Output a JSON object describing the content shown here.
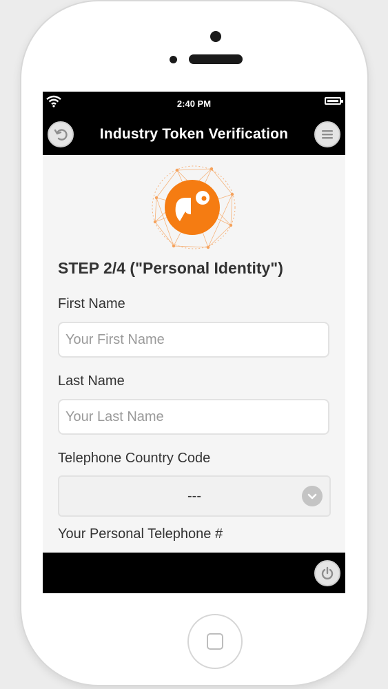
{
  "status_bar": {
    "time": "2:40 PM"
  },
  "header": {
    "title": "Industry Token Verification"
  },
  "form": {
    "step_title": "STEP 2/4 (\"Personal Identity\")",
    "first_name": {
      "label": "First Name",
      "placeholder": "Your First Name",
      "value": ""
    },
    "last_name": {
      "label": "Last Name",
      "placeholder": "Your Last Name",
      "value": ""
    },
    "country_code": {
      "label": "Telephone Country Code",
      "selected": "---"
    },
    "telephone": {
      "label": "Your Personal Telephone #"
    }
  },
  "icons": {
    "wifi": "wifi-icon",
    "battery": "battery-icon",
    "back": "back-arrow-icon",
    "menu": "menu-icon",
    "chevron": "chevron-down-icon",
    "power": "power-icon",
    "logo": "brand-logo"
  },
  "colors": {
    "brand_orange": "#f57c12",
    "header_bg": "#000000"
  }
}
